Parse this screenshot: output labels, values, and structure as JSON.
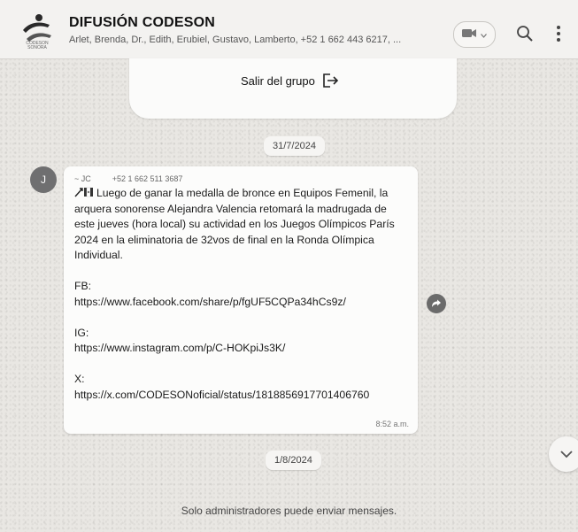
{
  "header": {
    "title": "DIFUSIÓN CODESON",
    "members": "Arlet, Brenda, Dr., Edith, Erubiel, Gustavo, Lamberto, +52 1 662 443 6217, ...",
    "logo_text": "CODESON SONORA",
    "icons": [
      "video-call-icon",
      "search-icon",
      "menu-icon"
    ]
  },
  "group_card": {
    "exit_label": "Salir del grupo"
  },
  "dates": {
    "first": "31/7/2024",
    "second": "1/8/2024"
  },
  "message": {
    "avatar_initial": "J",
    "sender_name": "~ JC",
    "sender_phone": "+52 1 662 511 3687",
    "text": "Luego de ganar la medalla de bronce en Equipos Femenil, la arquera sonorense Alejandra Valencia retomará la madrugada de este jueves (hora local) su actividad en los Juegos Olímpicos París 2024 en la eliminatoria de 32vos de final en la Ronda Olímpica Individual.",
    "fb_label": "FB:",
    "fb_link": "https://www.facebook.com/share/p/fgUF5CQPa34hCs9z/",
    "ig_label": "IG:",
    "ig_link": "https://www.instagram.com/p/C-HOKpiJs3K/",
    "x_label": "X:",
    "x_link": "https://x.com/CODESONoficial/status/1818856917701406760",
    "time": "8:52 a.m."
  },
  "footer": {
    "note": "Solo administradores puede enviar mensajes."
  }
}
